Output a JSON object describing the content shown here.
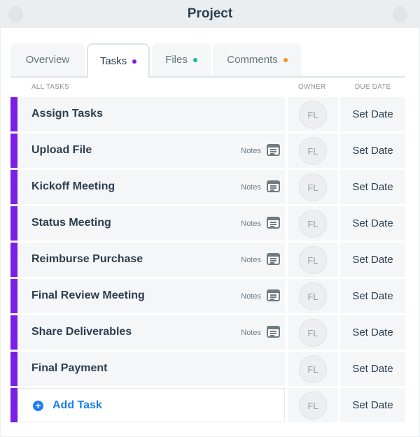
{
  "window": {
    "title": "Project"
  },
  "tabs": [
    {
      "label": "Overview",
      "active": false,
      "dot_color": null
    },
    {
      "label": "Tasks",
      "active": true,
      "dot_color": "#7b1fe4"
    },
    {
      "label": "Files",
      "active": false,
      "dot_color": "#19b9a0"
    },
    {
      "label": "Comments",
      "active": false,
      "dot_color": "#f7941d"
    }
  ],
  "columns": {
    "tasks": "ALL TASKS",
    "owner": "OWNER",
    "due_date": "DUE DATE"
  },
  "accent_color": "#7b1fe4",
  "tasks": [
    {
      "name": "Assign Tasks",
      "notes": null,
      "owner": "FL",
      "due": "Set Date"
    },
    {
      "name": "Upload File",
      "notes": "Notes",
      "owner": "FL",
      "due": "Set Date"
    },
    {
      "name": "Kickoff Meeting",
      "notes": "Notes",
      "owner": "FL",
      "due": "Set Date"
    },
    {
      "name": "Status Meeting",
      "notes": "Notes",
      "owner": "FL",
      "due": "Set Date"
    },
    {
      "name": "Reimburse Purchase",
      "notes": "Notes",
      "owner": "FL",
      "due": "Set Date"
    },
    {
      "name": "Final Review Meeting",
      "notes": "Notes",
      "owner": "FL",
      "due": "Set Date"
    },
    {
      "name": "Share Deliverables",
      "notes": "Notes",
      "owner": "FL",
      "due": "Set Date"
    },
    {
      "name": "Final Payment",
      "notes": null,
      "owner": "FL",
      "due": "Set Date"
    }
  ],
  "add_task": {
    "label": "Add Task",
    "icon": "plus-circle-icon",
    "owner": "FL",
    "due": "Set Date"
  }
}
